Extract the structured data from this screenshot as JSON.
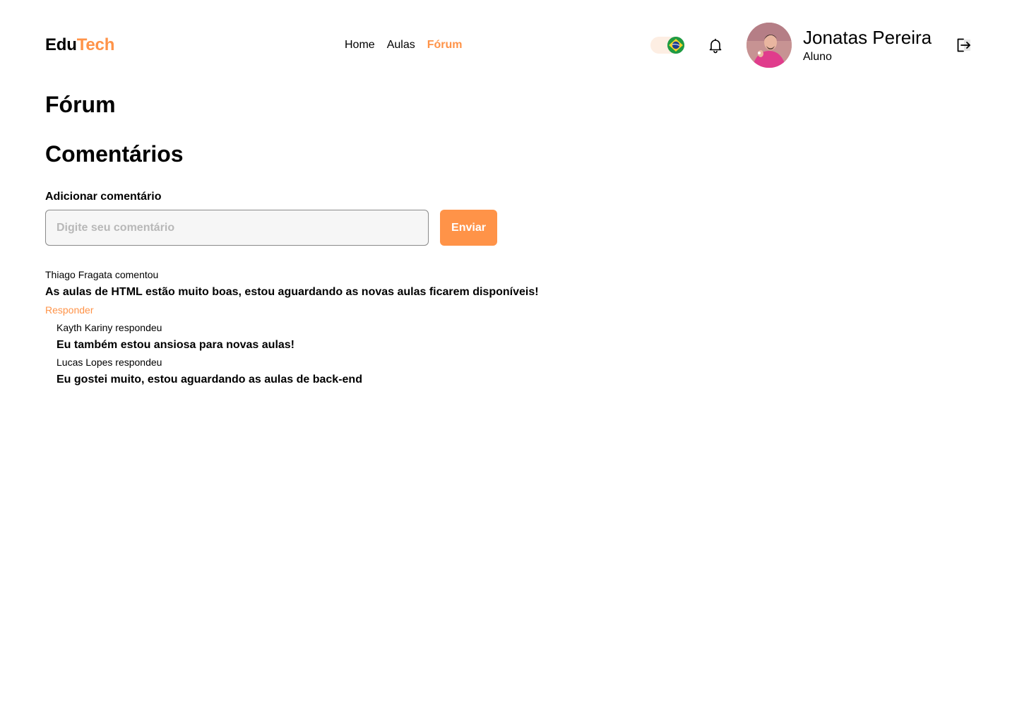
{
  "header": {
    "logo_part1": "Edu",
    "logo_part2": "Tech",
    "nav": [
      {
        "label": "Home",
        "active": false
      },
      {
        "label": "Aulas",
        "active": false
      },
      {
        "label": "Fórum",
        "active": true
      }
    ],
    "language_icon": "brazil-flag-icon",
    "notification_icon": "bell-icon",
    "logout_icon": "logout-icon",
    "user": {
      "name": "Jonatas Pereira",
      "role": "Aluno"
    }
  },
  "page": {
    "title": "Fórum",
    "section_title": "Comentários",
    "add_comment_label": "Adicionar comentário",
    "input_placeholder": "Digite seu comentário",
    "input_value": "",
    "send_label": "Enviar"
  },
  "comments": [
    {
      "author_line": "Thiago Fragata comentou",
      "text": "As aulas de HTML estão muito boas, estou aguardando as novas aulas ficarem disponíveis!",
      "reply_label": "Responder",
      "replies": [
        {
          "author_line": "Kayth Kariny respondeu",
          "text": "Eu também estou ansiosa para novas aulas!"
        },
        {
          "author_line": "Lucas Lopes respondeu",
          "text": "Eu gostei muito, estou aguardando as aulas de back-end"
        }
      ]
    }
  ],
  "colors": {
    "accent": "#ff9348",
    "text": "#000000",
    "input_bg": "#f6f6f6"
  }
}
